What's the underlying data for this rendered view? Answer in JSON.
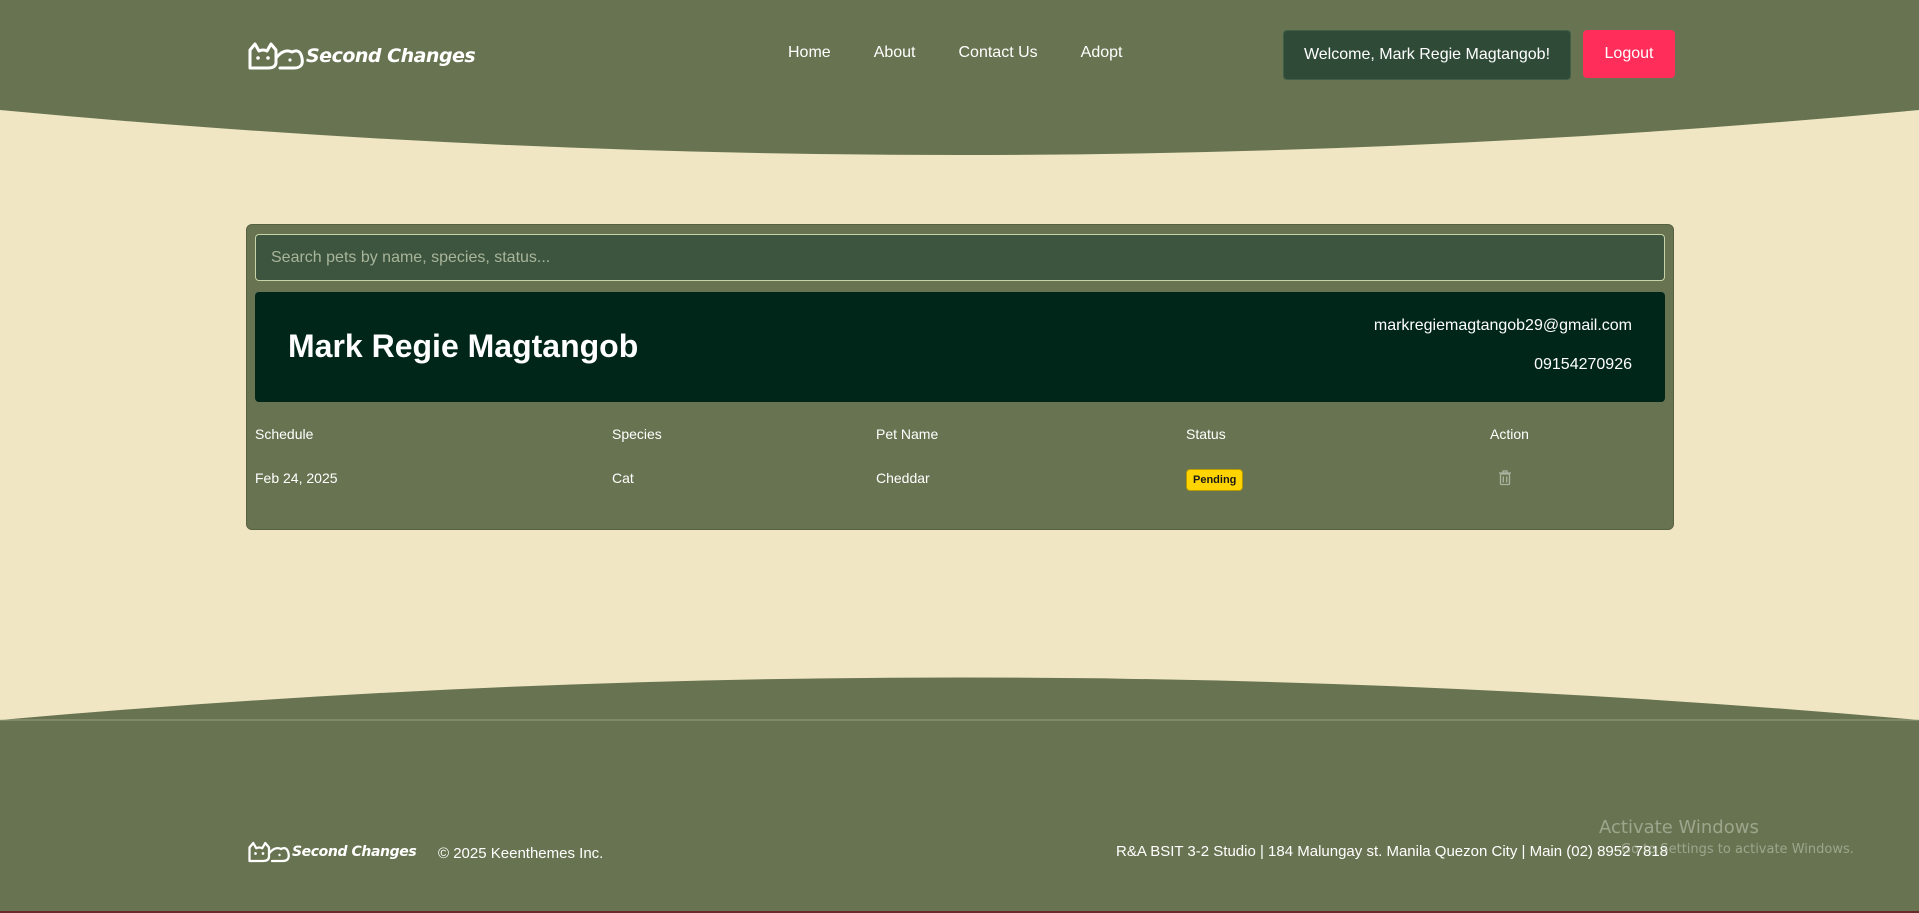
{
  "brand": {
    "name": "Second Changes",
    "icon": "cat-dog-logo-icon"
  },
  "nav": {
    "items": [
      {
        "label": "Home"
      },
      {
        "label": "About"
      },
      {
        "label": "Contact Us"
      },
      {
        "label": "Adopt"
      }
    ]
  },
  "header": {
    "welcome": "Welcome, Mark Regie Magtangob!",
    "logout": "Logout"
  },
  "search": {
    "placeholder": "Search pets by name, species, status...",
    "value": ""
  },
  "profile": {
    "name": "Mark Regie Magtangob",
    "email": "markregiemagtangob29@gmail.com",
    "phone": "09154270926"
  },
  "table": {
    "headers": [
      "Schedule",
      "Species",
      "Pet Name",
      "Status",
      "Action"
    ],
    "rows": [
      {
        "schedule": "Feb 24, 2025",
        "species": "Cat",
        "pet_name": "Cheddar",
        "status": "Pending",
        "action_icon": "trash-icon"
      }
    ]
  },
  "footer": {
    "copyright": "© 2025 Keenthemes Inc.",
    "address": "R&A BSIT 3-2 Studio | 184 Malungay st. Manila Quezon City | Main (02) 8952 7818"
  },
  "os_overlay": {
    "line1": "Activate Windows",
    "line2": "Go to Settings to activate Windows."
  },
  "colors": {
    "header_green": "#687451",
    "background_cream": "#f0e6c3",
    "profile_dark": "#00261a",
    "search_bg": "#3d553e",
    "welcome_bg": "#2f4b38",
    "logout_red": "#ff2d5a",
    "pending_yellow": "#ffd400"
  }
}
